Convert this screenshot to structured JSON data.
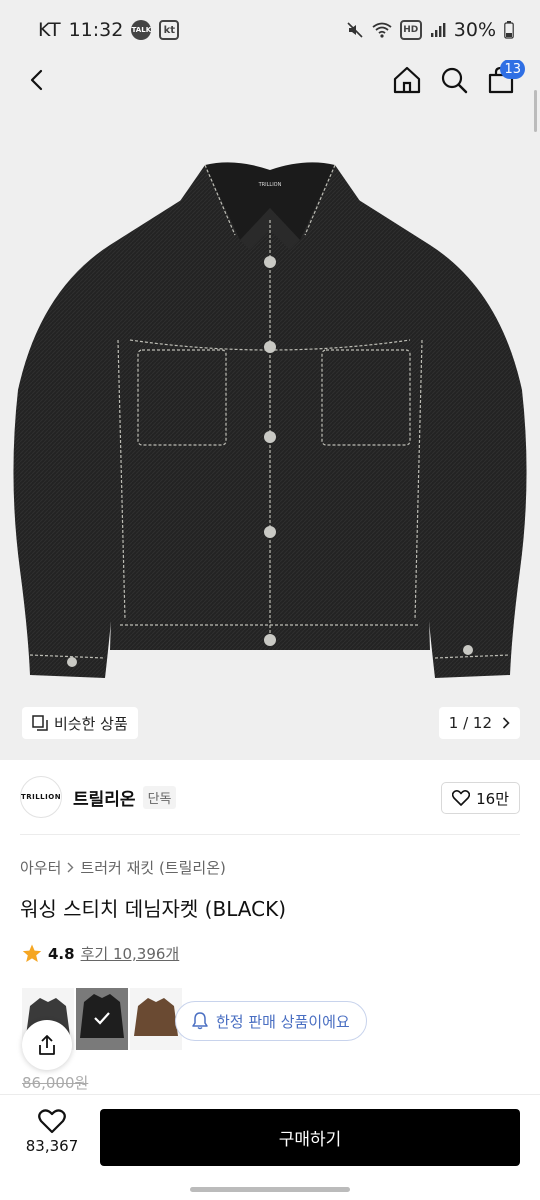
{
  "status": {
    "carrier": "KT",
    "time": "11:32",
    "talk_badge": "TALK",
    "kt_badge": "kt",
    "hd_label": "HD",
    "battery": "30%"
  },
  "nav": {
    "cart_count": "13"
  },
  "hero": {
    "similar_label": "비슷한 상품",
    "page_counter": "1 / 12",
    "garment_label": "TRILLION"
  },
  "brand": {
    "logo_text": "TRILLION",
    "name": "트릴리온",
    "tag": "단독",
    "likes": "16만"
  },
  "product": {
    "breadcrumb": [
      "아우터",
      "트러커 재킷 (트릴리온)"
    ],
    "title": "워싱 스티치 데님자켓 (BLACK)",
    "rating": "4.8",
    "reviews": "후기 10,396개",
    "limited_notice": "한정 판매 상품이에요",
    "original_price": "86,000원"
  },
  "bottom": {
    "fav_count": "83,367",
    "buy_label": "구매하기"
  },
  "colors": {
    "accent_blue": "#2f6fe4",
    "star": "#f5a623",
    "buy_button": "#000000"
  }
}
